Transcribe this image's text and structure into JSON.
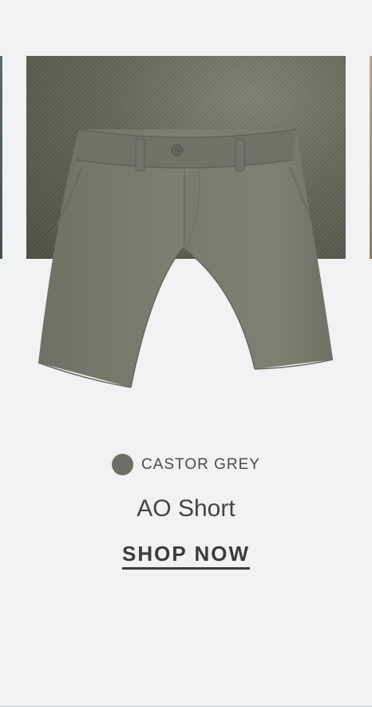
{
  "product": {
    "color_name": "CASTOR GREY",
    "swatch_color": "#6b7063",
    "name": "AO Short",
    "cta_label": "SHOP NOW"
  },
  "colors": {
    "background": "#f0f2f4",
    "fabric": "#5f6356",
    "shorts": "#7a7e70",
    "text": "#444444"
  }
}
